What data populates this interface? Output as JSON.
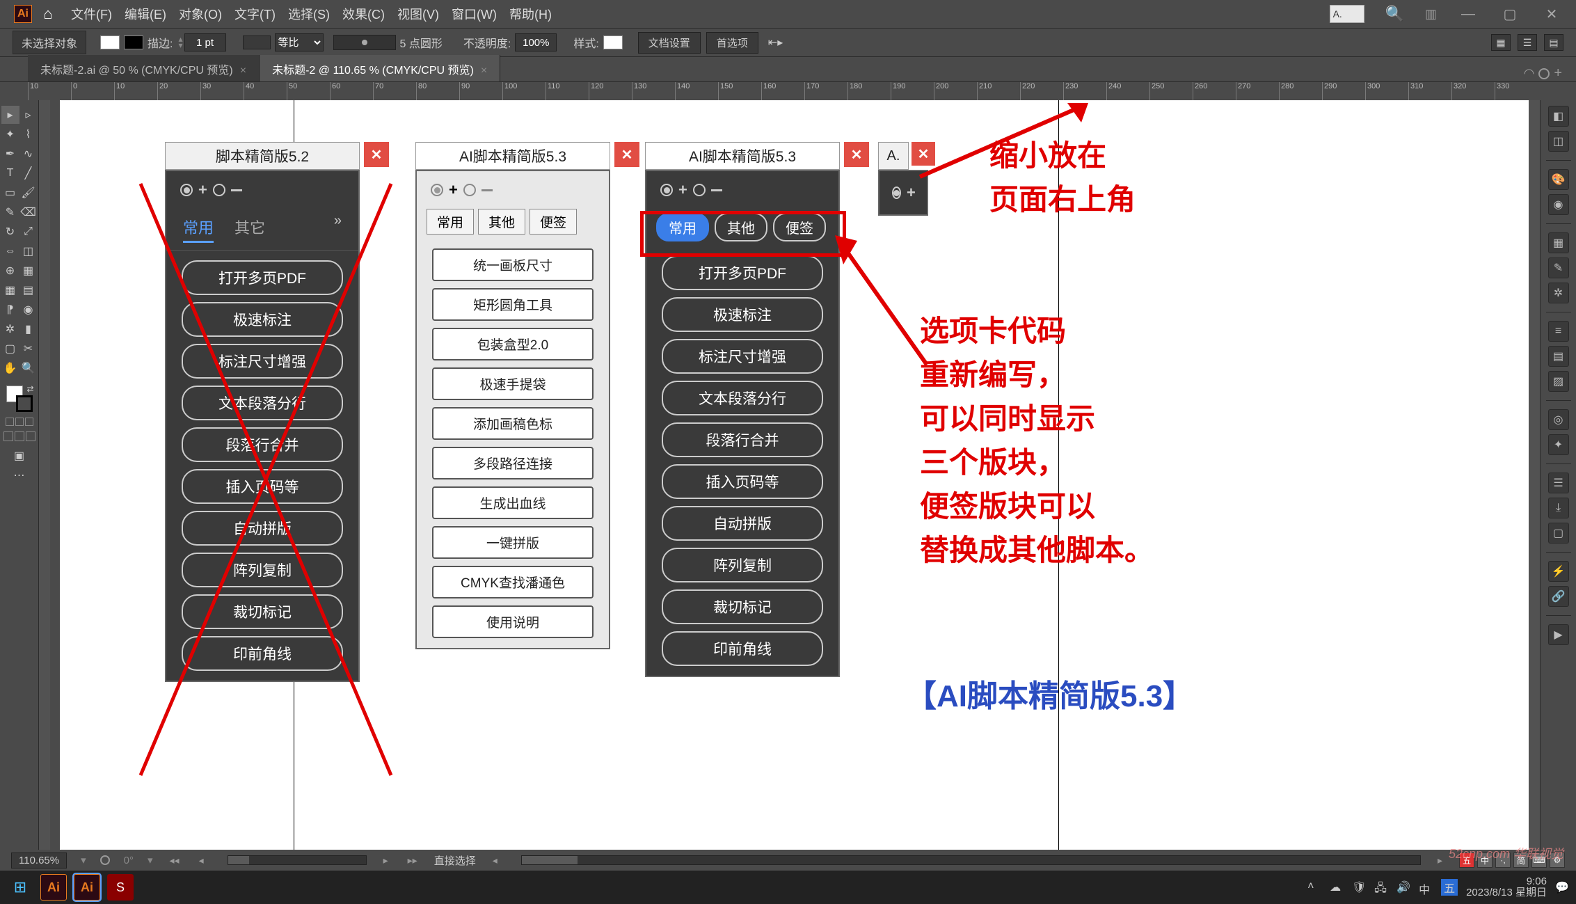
{
  "topbar": {
    "logo": "Ai",
    "menus": [
      "文件(F)",
      "编辑(E)",
      "对象(O)",
      "文字(T)",
      "选择(S)",
      "效果(C)",
      "视图(V)",
      "窗口(W)",
      "帮助(H)"
    ],
    "tiny_panel_label": "A.",
    "search_icon": "search",
    "win": [
      "—",
      "▢",
      "✕"
    ]
  },
  "controlbar": {
    "no_selection": "未选择对象",
    "stroke_label": "描边:",
    "stroke_value": "1 pt",
    "uniform_label": "等比",
    "brush_label": "5 点圆形",
    "opacity_label": "不透明度:",
    "opacity_value": "100%",
    "style_label": "样式:",
    "doc_setup": "文档设置",
    "prefs": "首选项"
  },
  "tabs": [
    {
      "label": "未标题-2.ai @ 50 % (CMYK/CPU 预览)",
      "active": false
    },
    {
      "label": "未标题-2 @ 110.65 % (CMYK/CPU 预览)",
      "active": true
    }
  ],
  "ruler_ticks": [
    "10",
    "0",
    "10",
    "20",
    "30",
    "40",
    "50",
    "60",
    "70",
    "80",
    "90",
    "100",
    "110",
    "120",
    "130",
    "140",
    "150",
    "160",
    "170",
    "180",
    "190",
    "200",
    "210",
    "220",
    "230",
    "240",
    "250",
    "260",
    "270",
    "280",
    "290",
    "300",
    "310",
    "320",
    "330"
  ],
  "panel1": {
    "title": "脚本精简版5.2",
    "tabs": [
      "常用",
      "其它"
    ],
    "buttons": [
      "打开多页PDF",
      "极速标注",
      "标注尺寸增强",
      "文本段落分行",
      "段落行合并",
      "插入页码等",
      "自动拼版",
      "阵列复制",
      "裁切标记",
      "印前角线"
    ]
  },
  "panel2": {
    "title": "AI脚本精简版5.3",
    "tabs": [
      "常用",
      "其他",
      "便签"
    ],
    "buttons": [
      "统一画板尺寸",
      "矩形圆角工具",
      "包装盒型2.0",
      "极速手提袋",
      "添加画稿色标",
      "多段路径连接",
      "生成出血线",
      "一键拼版",
      "CMYK查找潘通色",
      "使用说明"
    ]
  },
  "panel3": {
    "title": "AI脚本精简版5.3",
    "tabs": [
      "常用",
      "其他",
      "便签"
    ],
    "buttons": [
      "打开多页PDF",
      "极速标注",
      "标注尺寸增强",
      "文本段落分行",
      "段落行合并",
      "插入页码等",
      "自动拼版",
      "阵列复制",
      "裁切标记",
      "印前角线"
    ]
  },
  "panel4": {
    "title": "A."
  },
  "annotations": {
    "top": "缩小放在\n页面右上角",
    "middle": "选项卡代码\n重新编写，\n可以同时显示\n三个版块，\n便签版块可以\n替换成其他脚本。",
    "bottom": "【AI脚本精简版5.3】"
  },
  "status": {
    "zoom": "110.65%",
    "selection_tool": "直接选择"
  },
  "taskbar": {
    "time": "9:06",
    "date": "2023/8/13 星期日",
    "ime": "五",
    "lang": "中"
  },
  "watermark": "52cnp.com 华联视觉"
}
